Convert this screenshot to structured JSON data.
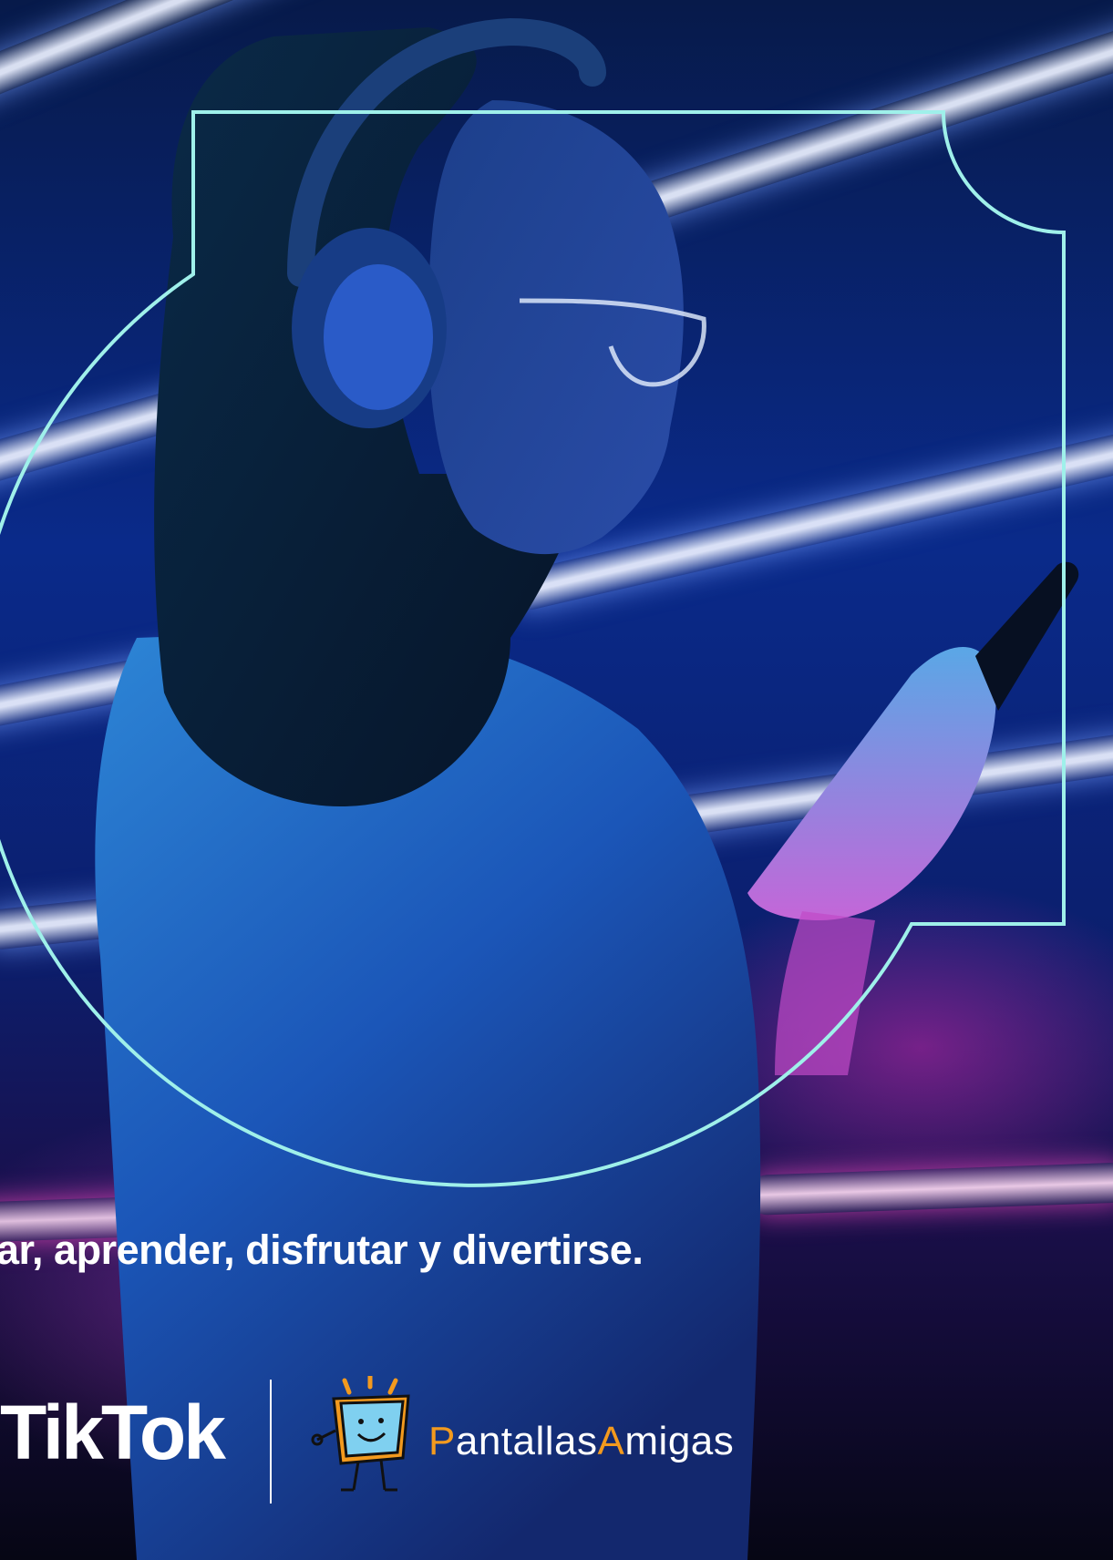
{
  "caption": "ar, aprender, disfrutar y divertirse.",
  "logos": {
    "tiktok": "TikTok",
    "pantallas_amigas": "PantallasAmigas"
  },
  "colors": {
    "frame_stroke": "#9ff0ea",
    "brand_orange": "#f39a1e",
    "text": "#ffffff"
  }
}
